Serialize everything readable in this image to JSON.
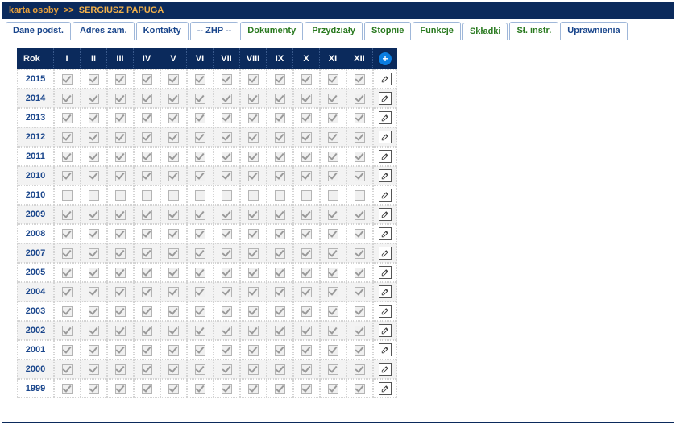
{
  "header": {
    "prefix": "karta osoby",
    "separator": ">>",
    "name": "SERGIUSZ PAPUGA"
  },
  "tabs": [
    {
      "label": "Dane podst.",
      "variant": "blue",
      "active": false
    },
    {
      "label": "Adres zam.",
      "variant": "blue",
      "active": false
    },
    {
      "label": "Kontakty",
      "variant": "blue",
      "active": false
    },
    {
      "label": "-- ZHP --",
      "variant": "blue",
      "active": false
    },
    {
      "label": "Dokumenty",
      "variant": "green",
      "active": false
    },
    {
      "label": "Przydziały",
      "variant": "green",
      "active": false
    },
    {
      "label": "Stopnie",
      "variant": "green",
      "active": false
    },
    {
      "label": "Funkcje",
      "variant": "green",
      "active": false
    },
    {
      "label": "Składki",
      "variant": "green",
      "active": true
    },
    {
      "label": "Sł. instr.",
      "variant": "green",
      "active": false
    },
    {
      "label": "Uprawnienia",
      "variant": "blue",
      "active": false
    }
  ],
  "table": {
    "yearHeader": "Rok",
    "months": [
      "I",
      "II",
      "III",
      "IV",
      "V",
      "VI",
      "VII",
      "VIII",
      "IX",
      "X",
      "XI",
      "XII"
    ],
    "addGlyph": "+",
    "rows": [
      {
        "year": "2015",
        "paid": [
          1,
          1,
          1,
          1,
          1,
          1,
          1,
          1,
          1,
          1,
          1,
          1
        ]
      },
      {
        "year": "2014",
        "paid": [
          1,
          1,
          1,
          1,
          1,
          1,
          1,
          1,
          1,
          1,
          1,
          1
        ]
      },
      {
        "year": "2013",
        "paid": [
          1,
          1,
          1,
          1,
          1,
          1,
          1,
          1,
          1,
          1,
          1,
          1
        ]
      },
      {
        "year": "2012",
        "paid": [
          1,
          1,
          1,
          1,
          1,
          1,
          1,
          1,
          1,
          1,
          1,
          1
        ]
      },
      {
        "year": "2011",
        "paid": [
          1,
          1,
          1,
          1,
          1,
          1,
          1,
          1,
          1,
          1,
          1,
          1
        ]
      },
      {
        "year": "2010",
        "paid": [
          1,
          1,
          1,
          1,
          1,
          1,
          1,
          1,
          1,
          1,
          1,
          1
        ]
      },
      {
        "year": "2010",
        "paid": [
          0,
          0,
          0,
          0,
          0,
          0,
          0,
          0,
          0,
          0,
          0,
          0
        ]
      },
      {
        "year": "2009",
        "paid": [
          1,
          1,
          1,
          1,
          1,
          1,
          1,
          1,
          1,
          1,
          1,
          1
        ]
      },
      {
        "year": "2008",
        "paid": [
          1,
          1,
          1,
          1,
          1,
          1,
          1,
          1,
          1,
          1,
          1,
          1
        ]
      },
      {
        "year": "2007",
        "paid": [
          1,
          1,
          1,
          1,
          1,
          1,
          1,
          1,
          1,
          1,
          1,
          1
        ]
      },
      {
        "year": "2005",
        "paid": [
          1,
          1,
          1,
          1,
          1,
          1,
          1,
          1,
          1,
          1,
          1,
          1
        ]
      },
      {
        "year": "2004",
        "paid": [
          1,
          1,
          1,
          1,
          1,
          1,
          1,
          1,
          1,
          1,
          1,
          1
        ]
      },
      {
        "year": "2003",
        "paid": [
          1,
          1,
          1,
          1,
          1,
          1,
          1,
          1,
          1,
          1,
          1,
          1
        ]
      },
      {
        "year": "2002",
        "paid": [
          1,
          1,
          1,
          1,
          1,
          1,
          1,
          1,
          1,
          1,
          1,
          1
        ]
      },
      {
        "year": "2001",
        "paid": [
          1,
          1,
          1,
          1,
          1,
          1,
          1,
          1,
          1,
          1,
          1,
          1
        ]
      },
      {
        "year": "2000",
        "paid": [
          1,
          1,
          1,
          1,
          1,
          1,
          1,
          1,
          1,
          1,
          1,
          1
        ]
      },
      {
        "year": "1999",
        "paid": [
          1,
          1,
          1,
          1,
          1,
          1,
          1,
          1,
          1,
          1,
          1,
          1
        ]
      }
    ]
  }
}
